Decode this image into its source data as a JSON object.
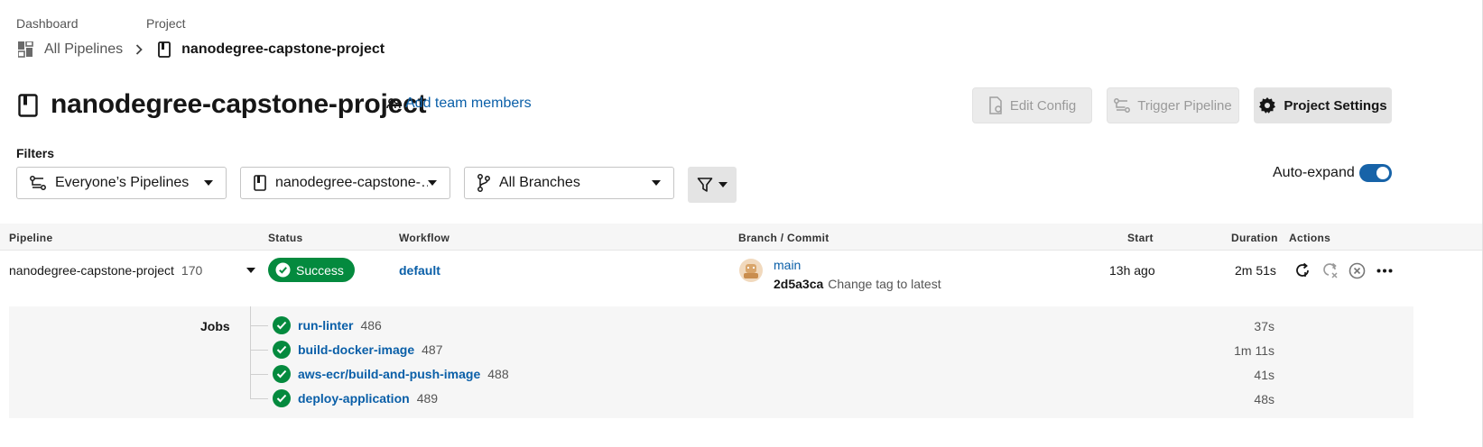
{
  "breadcrumb": {
    "dashboard_label": "Dashboard",
    "project_label": "Project",
    "all_pipelines": "All Pipelines",
    "current_project": "nanodegree-capstone-project"
  },
  "header": {
    "title": "nanodegree-capstone-project",
    "add_team": "Add team members",
    "edit_config": "Edit Config",
    "trigger_pipeline": "Trigger Pipeline",
    "project_settings": "Project Settings"
  },
  "filters": {
    "label": "Filters",
    "pipelines_select": "Everyone’s Pipelines",
    "project_select": "nanodegree-capstone-…",
    "branch_select": "All Branches",
    "auto_expand_label": "Auto-expand",
    "auto_expand_on": true
  },
  "table": {
    "headers": {
      "pipeline": "Pipeline",
      "status": "Status",
      "workflow": "Workflow",
      "branch_commit": "Branch / Commit",
      "start": "Start",
      "duration": "Duration",
      "actions": "Actions"
    },
    "row": {
      "pipeline_name": "nanodegree-capstone-project",
      "pipeline_number": "170",
      "status": "Success",
      "workflow": "default",
      "branch": "main",
      "commit_sha": "2d5a3ca",
      "commit_message": "Change tag to latest",
      "start": "13h ago",
      "duration": "2m 51s"
    },
    "jobs_label": "Jobs",
    "jobs": [
      {
        "name": "run-linter",
        "number": "486",
        "duration": "37s"
      },
      {
        "name": "build-docker-image",
        "number": "487",
        "duration": "1m 11s"
      },
      {
        "name": "aws-ecr/build-and-push-image",
        "number": "488",
        "duration": "41s"
      },
      {
        "name": "deploy-application",
        "number": "489",
        "duration": "48s"
      }
    ]
  },
  "colors": {
    "link": "#0a5fa8",
    "success": "#048a3e",
    "toggle": "#1763a8"
  }
}
